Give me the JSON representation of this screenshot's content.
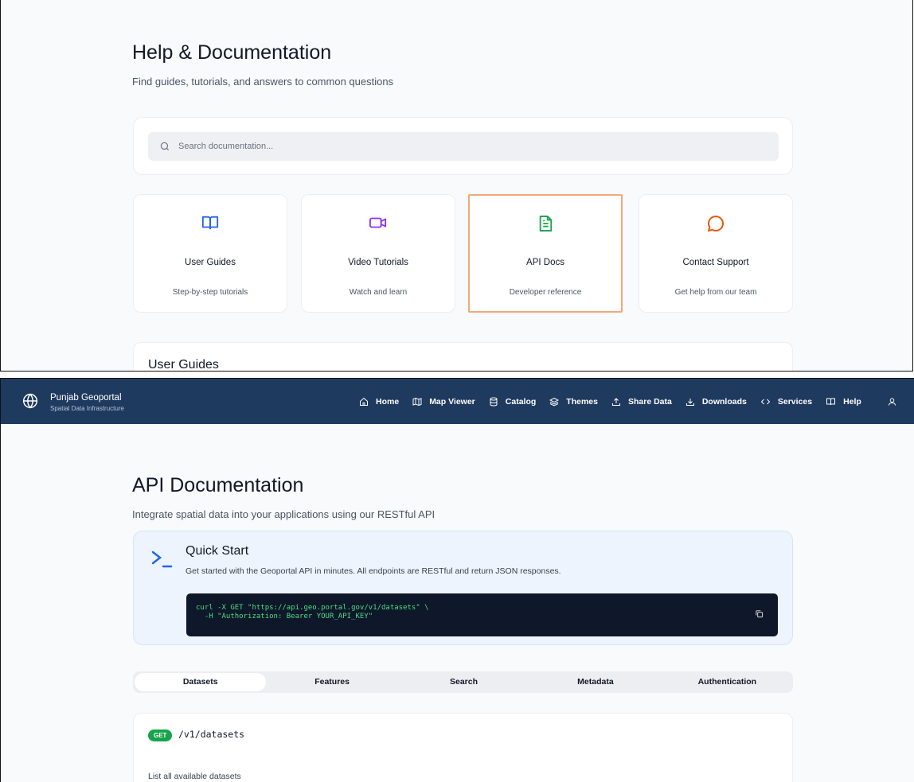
{
  "help": {
    "title": "Help & Documentation",
    "subtitle": "Find guides, tutorials, and answers to common questions",
    "search_placeholder": "Search documentation...",
    "cards": [
      {
        "title": "User Guides",
        "desc": "Step-by-step tutorials",
        "icon": "book-open-icon",
        "color": "#2563eb"
      },
      {
        "title": "Video Tutorials",
        "desc": "Watch and learn",
        "icon": "video-icon",
        "color": "#9333ea"
      },
      {
        "title": "API Docs",
        "desc": "Developer reference",
        "icon": "file-text-icon",
        "color": "#16a34a"
      },
      {
        "title": "Contact Support",
        "desc": "Get help from our team",
        "icon": "message-circle-icon",
        "color": "#ea580c"
      }
    ],
    "section_title": "User Guides"
  },
  "nav": {
    "brand_title": "Punjab Geoportal",
    "brand_subtitle": "Spatial Data Infrastructure",
    "items": [
      {
        "label": "Home",
        "icon": "home-icon"
      },
      {
        "label": "Map Viewer",
        "icon": "map-icon"
      },
      {
        "label": "Catalog",
        "icon": "database-icon"
      },
      {
        "label": "Themes",
        "icon": "layers-icon"
      },
      {
        "label": "Share Data",
        "icon": "upload-icon"
      },
      {
        "label": "Downloads",
        "icon": "download-icon"
      },
      {
        "label": "Services",
        "icon": "code-icon"
      },
      {
        "label": "Help",
        "icon": "book-open-icon"
      }
    ],
    "bg_color": "#1f3a5f"
  },
  "api": {
    "title": "API Documentation",
    "subtitle": "Integrate spatial data into your applications using our RESTful API",
    "quick_start": {
      "title": "Quick Start",
      "desc": "Get started with the Geoportal API in minutes. All endpoints are RESTful and return JSON responses.",
      "code_line1": "curl -X GET \"https://api.geo.portal.gov/v1/datasets\" \\",
      "code_line2": "  -H \"Authorization: Bearer YOUR_API_KEY\""
    },
    "tabs": [
      "Datasets",
      "Features",
      "Search",
      "Metadata",
      "Authentication"
    ],
    "active_tab": "Datasets",
    "endpoint": {
      "method": "GET",
      "path": "/v1/datasets",
      "desc": "List all available datasets"
    }
  }
}
